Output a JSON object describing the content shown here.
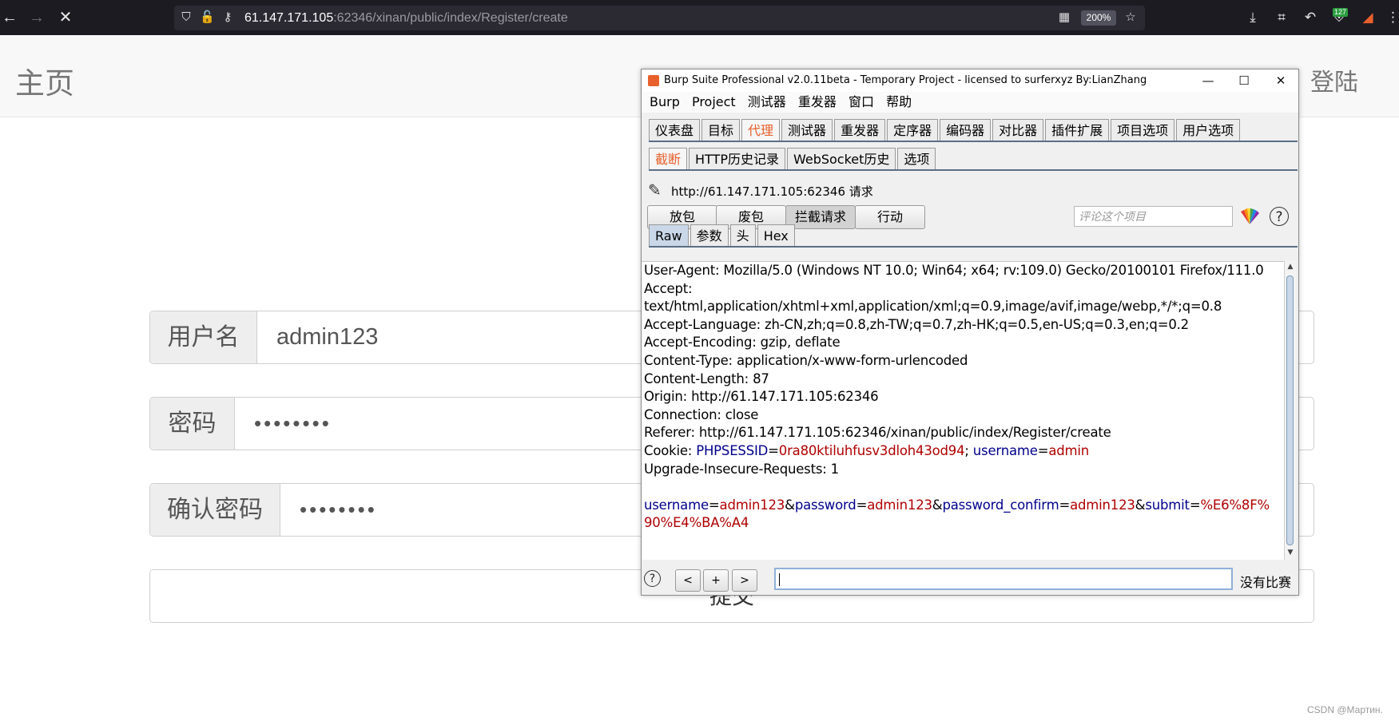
{
  "browser": {
    "url_host": "61.147.171.105",
    "url_rest": ":62346/xinan/public/index/Register/create",
    "zoom": "200%",
    "extension_badge": "127"
  },
  "page": {
    "brand": "主页",
    "login_link": "登陆",
    "username_label": "用户名",
    "username_value": "admin123",
    "password_label": "密码",
    "password_value": "••••••••",
    "confirm_label": "确认密码",
    "confirm_value": "••••••••",
    "submit_label": "提交"
  },
  "burp": {
    "title": "Burp Suite Professional v2.0.11beta - Temporary Project - licensed to surferxyz By:LianZhang",
    "menu": [
      "Burp",
      "Project",
      "测试器",
      "重发器",
      "窗口",
      "帮助"
    ],
    "main_tabs": [
      "仪表盘",
      "目标",
      "代理",
      "测试器",
      "重发器",
      "定序器",
      "编码器",
      "对比器",
      "插件扩展",
      "项目选项",
      "用户选项"
    ],
    "active_main_tab": "代理",
    "sub_tabs": [
      "截断",
      "HTTP历史记录",
      "WebSocket历史",
      "选项"
    ],
    "active_sub_tab": "截断",
    "request_label": "http://61.147.171.105:62346 请求",
    "actions": {
      "forward": "放包",
      "drop": "废包",
      "intercept": "拦截请求",
      "action": "行动"
    },
    "comment_placeholder": "评论这个项目",
    "view_tabs": [
      "Raw",
      "参数",
      "头",
      "Hex"
    ],
    "active_view_tab": "Raw",
    "request_lines": [
      "User-Agent: Mozilla/5.0 (Windows NT 10.0; Win64; x64; rv:109.0) Gecko/20100101 Firefox/111.0",
      "Accept:",
      "text/html,application/xhtml+xml,application/xml;q=0.9,image/avif,image/webp,*/*;q=0.8",
      "Accept-Language: zh-CN,zh;q=0.8,zh-TW;q=0.7,zh-HK;q=0.5,en-US;q=0.3,en;q=0.2",
      "Accept-Encoding: gzip, deflate",
      "Content-Type: application/x-www-form-urlencoded",
      "Content-Length: 87",
      "Origin: http://61.147.171.105:62346",
      "Connection: close",
      "Referer: http://61.147.171.105:62346/xinan/public/index/Register/create"
    ],
    "cookie": {
      "prefix": "Cookie: ",
      "k1": "PHPSESSID",
      "eq1": "=",
      "v1": "0ra80ktiluhfusv3dloh43od94",
      "sep": "; ",
      "k2": "username",
      "eq2": "=",
      "v2": "admin"
    },
    "upgrade_line": "Upgrade-Insecure-Requests: 1",
    "body": {
      "k1": "username",
      "v1": "admin123",
      "k2": "password",
      "v2": "admin123",
      "k3": "password_confirm",
      "v3": "admin123",
      "k4": "submit",
      "v4a": "%E6%8F%",
      "v4b": "90%E4%BA%A4",
      "eq": "=",
      "amp": "&"
    },
    "nav": {
      "prev": "<",
      "add": "+",
      "next": ">"
    },
    "match_text": "没有比赛"
  },
  "watermark": "CSDN @Мартин.",
  "colors": {
    "burp_accent": "#e8602c",
    "param_key": "#00008b",
    "param_value": "#b00000"
  }
}
